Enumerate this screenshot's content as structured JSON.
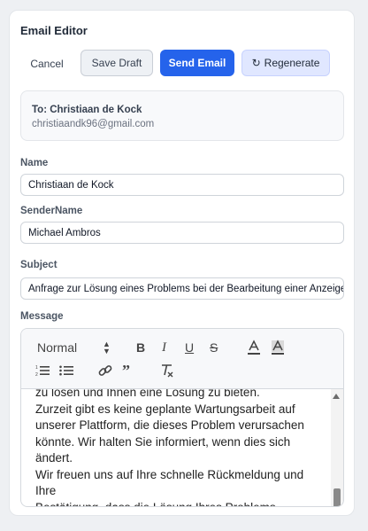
{
  "title": "Email Editor",
  "actions": {
    "cancel": "Cancel",
    "save_draft": "Save Draft",
    "send": "Send Email",
    "regenerate": "Regenerate",
    "regenerate_icon": "refresh-icon"
  },
  "recipient": {
    "to_line": "To: Christiaan de Kock",
    "email": "christiaandk96@gmail.com"
  },
  "fields": {
    "name_label": "Name",
    "name_value": "Christiaan de Kock",
    "sender_label": "SenderName",
    "sender_value": "Michael Ambros",
    "subject_label": "Subject",
    "subject_value": "Anfrage zur Lösung eines Problems bei der Bearbeitung einer Anzeige",
    "message_label": "Message"
  },
  "editor": {
    "heading_select": "Normal",
    "toolbar_icons": [
      "bold-icon",
      "italic-icon",
      "underline-icon",
      "strike-icon",
      "text-color-icon",
      "background-color-icon",
      "ordered-list-icon",
      "bullet-list-icon",
      "link-icon",
      "blockquote-icon",
      "clear-format-icon"
    ],
    "lines": [
      "zu lösen und Ihnen eine Lösung zu bieten.",
      "Zurzeit gibt es keine geplante Wartungsarbeit auf",
      "unserer Plattform, die dieses Problem verursachen",
      "könnte. Wir halten Sie informiert, wenn dies sich",
      "ändert.",
      "Wir freuen uns auf Ihre schnelle Rückmeldung und Ihre",
      "Bestätigung, dass die Lösung Ihres Problems"
    ]
  }
}
